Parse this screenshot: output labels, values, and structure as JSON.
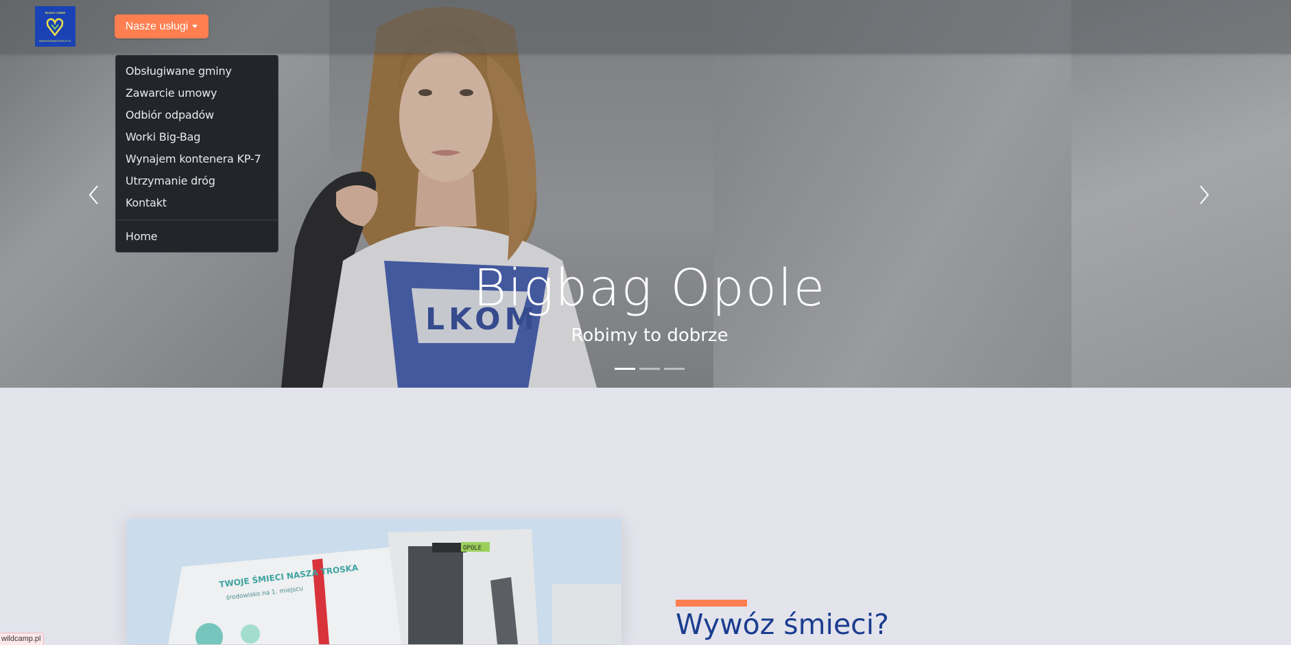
{
  "navbar": {
    "logo": {
      "top_text": "BLISKO CIEBIE",
      "bottom_text": "WWW.BIGBAGOPOLE.PL"
    },
    "services_button": {
      "label": "Nasze usługi",
      "icon": "caret-down-icon",
      "color": "#ff7f50"
    }
  },
  "dropdown": {
    "items": [
      {
        "label": "Obsługiwane gminy"
      },
      {
        "label": "Zawarcie umowy"
      },
      {
        "label": "Odbiór odpadów"
      },
      {
        "label": "Worki Big-Bag"
      },
      {
        "label": "Wynajem kontenera KP-7"
      },
      {
        "label": "Utrzymanie dróg"
      },
      {
        "label": "Kontakt"
      }
    ],
    "footer_item": {
      "label": "Home"
    }
  },
  "hero": {
    "title": "Bigbag Opole",
    "subtitle": "Robimy to dobrze",
    "shirt_text": "LKOM",
    "prev_icon": "chevron-left-icon",
    "next_icon": "chevron-right-icon",
    "indicators": {
      "count": 3,
      "active_index": 0
    }
  },
  "section": {
    "heading": "Wywóz śmieci?",
    "accent_color": "#ff7f50",
    "heading_color": "#1a3d8f",
    "truck_text": "TWOJE ŚMIECI NASZA TROSKA",
    "truck_subtext": "środowisko na 1. miejscu",
    "truck_plate": "OPOLE"
  },
  "status_bar": {
    "text": "wildcamp.pl"
  }
}
